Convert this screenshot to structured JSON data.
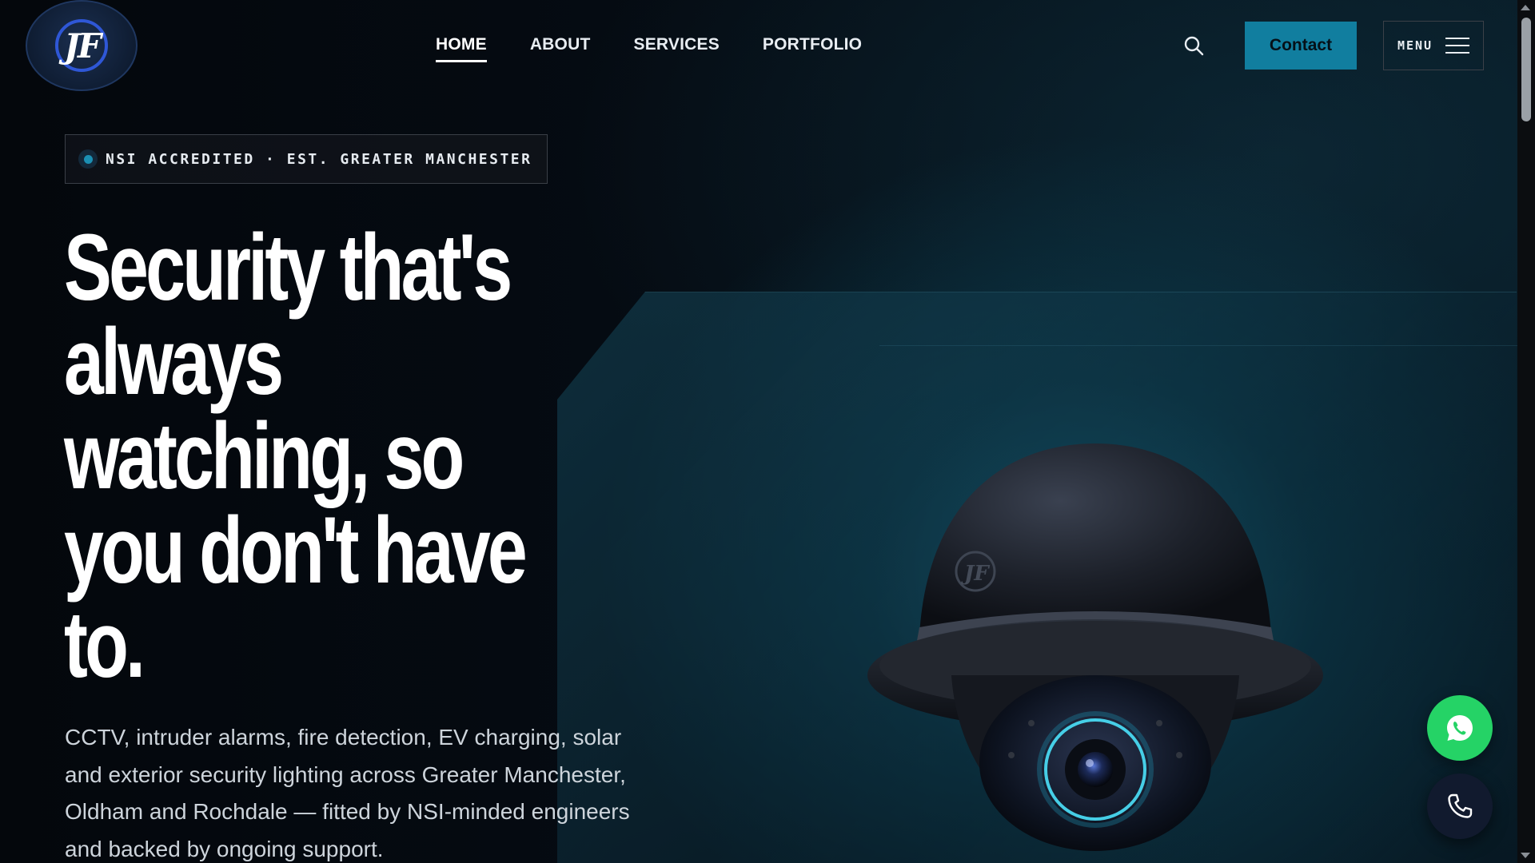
{
  "brand": {
    "logo_text": "JF"
  },
  "nav": {
    "items": [
      {
        "label": "HOME",
        "active": true
      },
      {
        "label": "ABOUT",
        "active": false
      },
      {
        "label": "SERVICES",
        "active": false
      },
      {
        "label": "PORTFOLIO",
        "active": false
      }
    ]
  },
  "header": {
    "search_icon": "search-icon",
    "contact_label": "Contact",
    "menu_label": "MENU",
    "menu_icon": "hamburger-icon"
  },
  "hero": {
    "badge": "NSI ACCREDITED · EST. GREATER MANCHESTER",
    "headline_lines": [
      "Security that's",
      "always",
      "watching, so",
      "you don't have",
      "to."
    ],
    "intro": "CCTV, intruder alarms, fire detection, EV charging, solar and exterior security lighting across Greater Manchester, Oldham and Rochdale — fitted by NSI-minded engineers and backed by ongoing support.",
    "camera_logo": "JF"
  },
  "floating": {
    "whatsapp_icon": "whatsapp-icon",
    "phone_icon": "phone-icon"
  },
  "colors": {
    "accent": "#117e9f",
    "whatsapp": "#25d366",
    "background": "#05090f"
  }
}
